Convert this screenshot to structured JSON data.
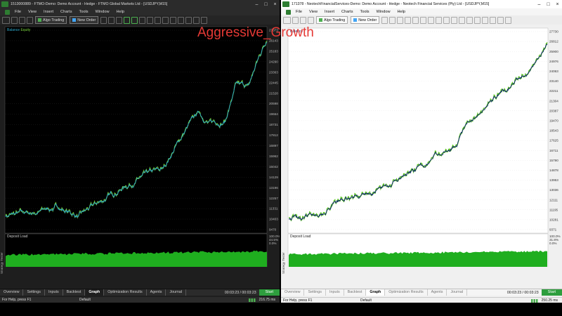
{
  "left_window": {
    "title": "1513000889 - FTMO-Demo: Demo Account - Hedge - FTMO Global Markets Ltd - [USDJPY,M15]",
    "menu": [
      "File",
      "View",
      "Insert",
      "Charts",
      "Tools",
      "Window",
      "Help"
    ],
    "toolbar": {
      "algo_trading": "Algo Trading",
      "new_order": "New Order"
    },
    "legend": {
      "balance": "Balance",
      "equity": "Equity"
    },
    "deposit_load_label": "Deposit Load",
    "side_tab": "Strategy Tester",
    "y_labels": [
      "27073",
      "26143",
      "25183",
      "24290",
      "23363",
      "22445",
      "21528",
      "20598",
      "19664",
      "18731",
      "17812",
      "16897",
      "15962",
      "15042",
      "14129",
      "13196",
      "12257",
      "11331",
      "10403",
      "9470"
    ],
    "x_labels": [
      "2020.01.23",
      "2020.08.06",
      "2021.04.29",
      "2021.11.02",
      "2022.04.26",
      "2022.09.06",
      "2023.03.09",
      "2023.06.15",
      "2023.11.09",
      "2024.06.03",
      "2024.11.23",
      "2025.03.25",
      "2025.08.12",
      "2025.12.13"
    ],
    "load_labels": [
      "100.0%",
      "44.5%",
      "0.0%"
    ],
    "tabs": [
      "Overview",
      "Settings",
      "Inputs",
      "Backtest",
      "Graph",
      "Optimization Results",
      "Agents",
      "Journal"
    ],
    "active_tab": "Graph",
    "timer": "00:03:23 / 00:03:23",
    "start": "Start",
    "status": {
      "help": "For Help, press F1",
      "profile": "Default",
      "ping": "216.75 ms"
    }
  },
  "right_window": {
    "title": "171378 - NeotechFinancialServices-Demo: Demo Account - Hedge - Neotech Financial Services (Pty) Ltd - [USDJPY,M15]",
    "menu": [
      "File",
      "View",
      "Insert",
      "Charts",
      "Tools",
      "Window",
      "Help"
    ],
    "toolbar": {
      "algo_trading": "Algo Trading",
      "new_order": "New Order"
    },
    "legend": {
      "balance": "Balance"
    },
    "deposit_load_label": "Deposit Load",
    "side_tab": "Strategy Tester",
    "y_labels": [
      "27730",
      "26812",
      "25900",
      "24976",
      "24063",
      "23140",
      "22211",
      "21304",
      "20387",
      "19470",
      "18543",
      "17625",
      "16711",
      "15790",
      "14878",
      "13953",
      "13036",
      "12111",
      "11195",
      "10281",
      "9371"
    ],
    "x_labels": [
      "2020.01.23",
      "2020.07.22",
      "2021.04.06",
      "2021.11.08",
      "2022.04.29",
      "2022.09.28",
      "2023.02.16",
      "2023.07.13",
      "2024.01.16",
      "2024.07.23",
      "2024.12.03",
      "2025.03.28",
      "2025.08.13",
      "2025.12.15"
    ],
    "load_labels": [
      "100.0%",
      "31.8%",
      "0.0%"
    ],
    "tabs": [
      "Overview",
      "Settings",
      "Inputs",
      "Backtest",
      "Graph",
      "Optimization Results",
      "Agents",
      "Journal"
    ],
    "active_tab": "Graph",
    "timer": "00:03:23 / 00:03:23",
    "start": "Start",
    "status": {
      "help": "For Help, press F1",
      "profile": "Default",
      "ping": "250.25 ms"
    }
  },
  "overlay_title": "Aggressive_Growth",
  "colors": {
    "left_line": "#2aa7c9",
    "left_equity": "#76d13a",
    "right_line": "#0d2a66",
    "right_equity": "#5ac41e",
    "load": "#1fae1f",
    "overlay": "#e53935"
  }
}
